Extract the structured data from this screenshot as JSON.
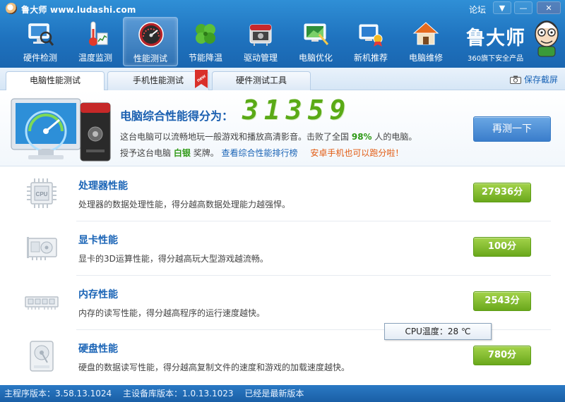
{
  "window": {
    "title": "鲁大师 www.ludashi.com",
    "forum": "论坛",
    "menu_glyph": "▼",
    "min_glyph": "—",
    "close_glyph": "✕"
  },
  "toolbar": [
    {
      "label": "硬件检测",
      "icon": "hardware-monitor-icon"
    },
    {
      "label": "温度监测",
      "icon": "thermometer-icon"
    },
    {
      "label": "性能测试",
      "icon": "speedometer-icon",
      "active": true
    },
    {
      "label": "节能降温",
      "icon": "clover-leaf-icon"
    },
    {
      "label": "驱动管理",
      "icon": "driver-chip-icon"
    },
    {
      "label": "电脑优化",
      "icon": "optimize-monitor-icon"
    },
    {
      "label": "新机推荐",
      "icon": "new-pc-award-icon"
    },
    {
      "label": "电脑维修",
      "icon": "house-repair-icon"
    }
  ],
  "brand": {
    "name": "鲁大师",
    "subtitle": "360旗下安全产品"
  },
  "tabs": [
    {
      "label": "电脑性能测试",
      "active": true
    },
    {
      "label": "手机性能测试",
      "badge": "new"
    },
    {
      "label": "硬件测试工具"
    }
  ],
  "save_screenshot": "保存截屏",
  "summary": {
    "score_label": "电脑综合性能得分为：",
    "score": "31359",
    "desc_prefix": "这台电脑可以流畅地玩一般游戏和播放高清影音。击败了全国",
    "desc_percent": "98%",
    "desc_suffix": "人的电脑。",
    "award_prefix": "授予这台电脑",
    "award_medal": "白银",
    "award_suffix": "奖牌。",
    "rank_link": "查看综合性能排行榜",
    "android_link": "安卓手机也可以跑分啦！",
    "retest": "再测一下"
  },
  "items": [
    {
      "title": "处理器性能",
      "desc": "处理器的数据处理性能，得分越高数据处理能力越强悍。",
      "score": "27936分",
      "icon": "cpu-chip-icon"
    },
    {
      "title": "显卡性能",
      "desc": "显卡的3D运算性能，得分越高玩大型游戏越流畅。",
      "score": "100分",
      "icon": "graphics-card-icon"
    },
    {
      "title": "内存性能",
      "desc": "内存的读写性能，得分越高程序的运行速度越快。",
      "score": "2543分",
      "icon": "memory-module-icon"
    },
    {
      "title": "硬盘性能",
      "desc": "硬盘的数据读写性能，得分越高复制文件的速度和游戏的加载速度越快。",
      "score": "780分",
      "icon": "hard-disk-icon"
    }
  ],
  "tooltip": "CPU温度：28 ℃",
  "status": {
    "main_version": "主程序版本：3.58.13.1024",
    "db_version": "主设备库版本：1.0.13.1023",
    "latest": "已经是最新版本"
  },
  "colors": {
    "header_blue": "#1f73bf",
    "score_green": "#5aaa16",
    "link_blue": "#1a64b6",
    "badge_green": "#6aa81c",
    "promo_orange": "#e25a10"
  }
}
